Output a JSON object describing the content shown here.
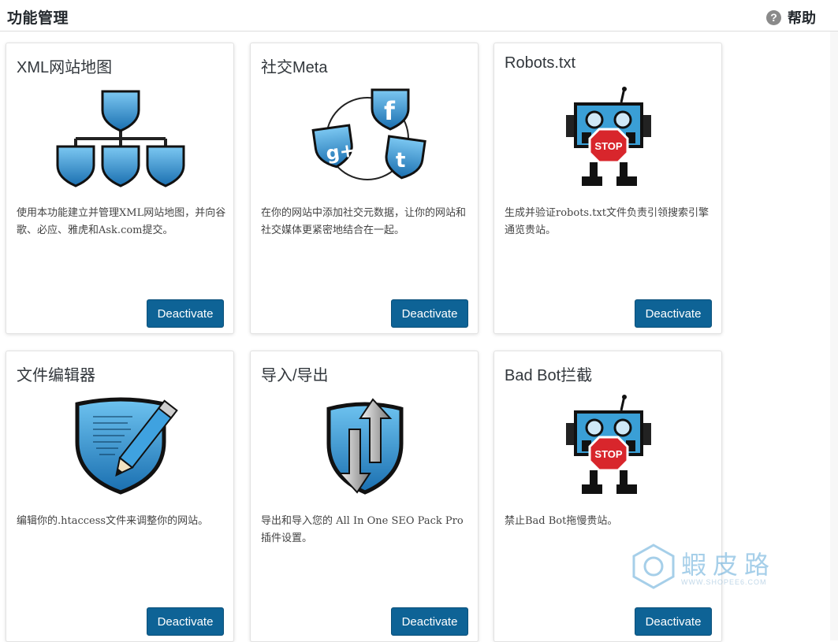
{
  "header": {
    "title": "功能管理",
    "help_label": "帮助",
    "help_icon": "?"
  },
  "cards": [
    {
      "title": "XML网站地图",
      "icon": "sitemap-icon",
      "desc": "使用本功能建立并管理XML网站地图，并向谷歌、必应、雅虎和Ask.com提交。",
      "button": "Deactivate"
    },
    {
      "title": "社交Meta",
      "icon": "social-meta-icon",
      "desc": "在你的网站中添加社交元数据，让你的网站和社交媒体更紧密地结合在一起。",
      "button": "Deactivate"
    },
    {
      "title": "Robots.txt",
      "icon": "robot-stop-icon",
      "desc": "生成并验证robots.txt文件负责引领搜索引擎通览贵站。",
      "button": "Deactivate"
    },
    {
      "title": "文件编辑器",
      "icon": "file-editor-icon",
      "desc": "编辑你的.htaccess文件来调整你的网站。",
      "button": "Deactivate"
    },
    {
      "title": "导入/导出",
      "icon": "import-export-icon",
      "desc": "导出和导入您的 All In One SEO Pack Pro 插件设置。",
      "button": "Deactivate"
    },
    {
      "title": "Bad Bot拦截",
      "icon": "bad-bot-icon",
      "desc": "禁止Bad Bot拖慢贵站。",
      "button": "Deactivate"
    }
  ],
  "watermark": {
    "text": "蝦皮路",
    "url": "WWW.SHOPEE6.COM"
  },
  "colors": {
    "button": "#0e6396",
    "shield_blue": "#2a8fd0",
    "robot_blue": "#3a9fd6",
    "stop_red": "#d8262c"
  }
}
